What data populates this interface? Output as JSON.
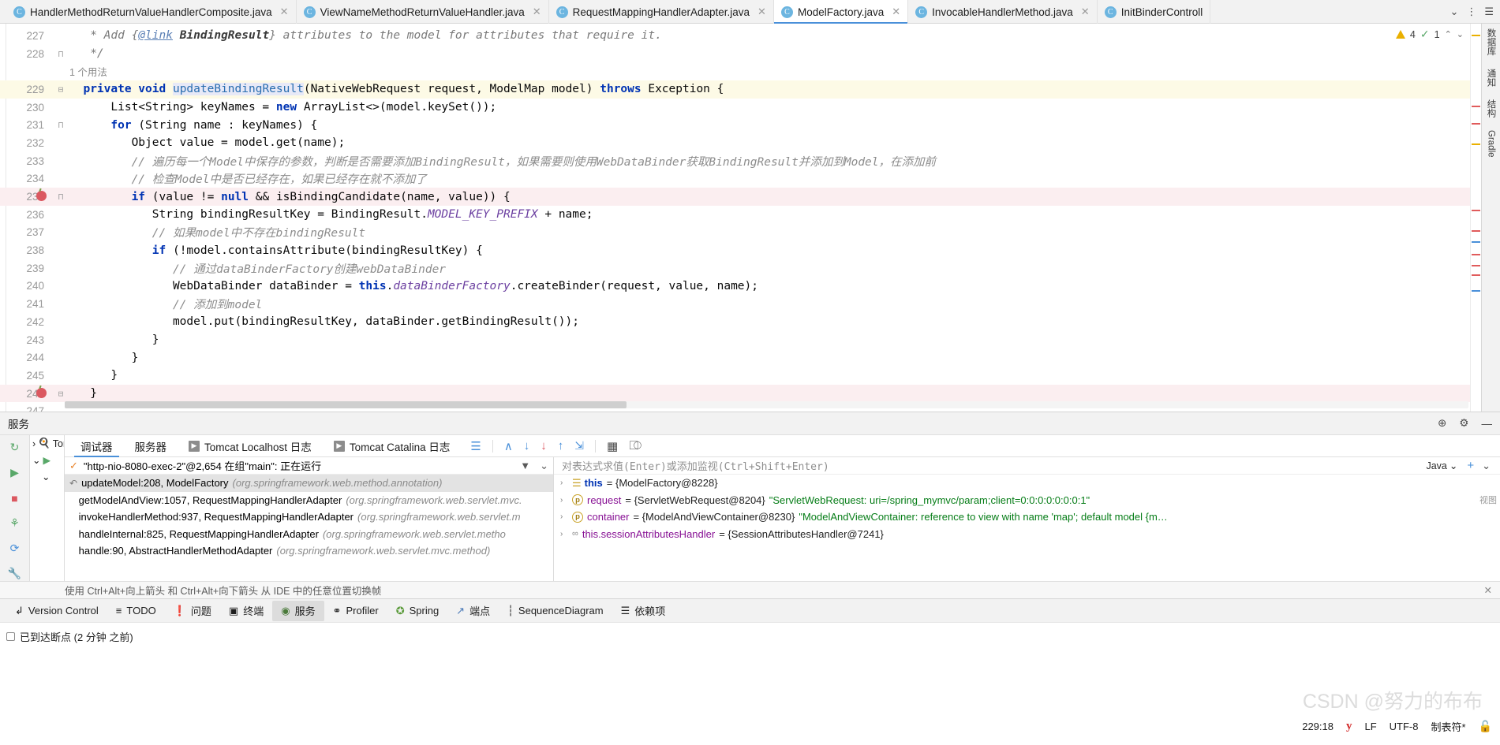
{
  "tabs": [
    {
      "label": "HandlerMethodReturnValueHandlerComposite.java",
      "icon": "java-class-icon",
      "active": false,
      "closable": true
    },
    {
      "label": "ViewNameMethodReturnValueHandler.java",
      "icon": "java-class-icon",
      "active": false,
      "closable": true
    },
    {
      "label": "RequestMappingHandlerAdapter.java",
      "icon": "java-class-icon",
      "active": false,
      "closable": true
    },
    {
      "label": "ModelFactory.java",
      "icon": "java-class-icon",
      "active": true,
      "closable": true
    },
    {
      "label": "InvocableHandlerMethod.java",
      "icon": "java-class-icon",
      "active": false,
      "closable": true
    },
    {
      "label": "InitBinderControll",
      "icon": "java-class-icon",
      "active": false,
      "closable": false
    }
  ],
  "tabbar": {
    "overflow_label": "⌄",
    "more_label": "⋮",
    "db_label": "☰"
  },
  "editor": {
    "inspection": {
      "warning_count": "4",
      "ok_count": "1",
      "chevron_up": "⌃",
      "chevron_down": "⌄"
    },
    "lines": [
      {
        "no": "227",
        "fold": "",
        "bp": false,
        "hl": "",
        "segs": [
          {
            "t": "   * Add {",
            "c": "cmtdoc"
          },
          {
            "t": "@link",
            "c": "lnk"
          },
          {
            "t": " ",
            "c": "cmtdoc"
          },
          {
            "t": "BindingResult",
            "c": "bold"
          },
          {
            "t": "} attributes to the model for attributes that require it.",
            "c": "cmtdoc"
          }
        ]
      },
      {
        "no": "228",
        "fold": "⊓",
        "bp": false,
        "hl": "",
        "segs": [
          {
            "t": "   */",
            "c": "cmtdoc"
          }
        ]
      },
      {
        "no": "",
        "fold": "",
        "bp": false,
        "hl": "",
        "usage": "1 个用法"
      },
      {
        "no": "229",
        "fold": "⊟",
        "bp": false,
        "hl": "hl2",
        "segs": [
          {
            "t": "  ",
            "c": "txt"
          },
          {
            "t": "private void ",
            "c": "kw"
          },
          {
            "t": "updateBindingResult",
            "c": "mthdecl"
          },
          {
            "t": "(NativeWebRequest request, ModelMap model) ",
            "c": "txt"
          },
          {
            "t": "throws ",
            "c": "kw"
          },
          {
            "t": "Exception {",
            "c": "txt"
          }
        ]
      },
      {
        "no": "230",
        "fold": "",
        "bp": false,
        "hl": "",
        "segs": [
          {
            "t": "      List<String> keyNames = ",
            "c": "txt"
          },
          {
            "t": "new ",
            "c": "kw"
          },
          {
            "t": "ArrayList<>(model.keySet());",
            "c": "txt"
          }
        ]
      },
      {
        "no": "231",
        "fold": "⊓",
        "bp": false,
        "hl": "",
        "segs": [
          {
            "t": "      ",
            "c": "txt"
          },
          {
            "t": "for ",
            "c": "kw"
          },
          {
            "t": "(String name : keyNames) {",
            "c": "txt"
          }
        ]
      },
      {
        "no": "232",
        "fold": "",
        "bp": false,
        "hl": "",
        "segs": [
          {
            "t": "         Object value = model.get(name);",
            "c": "txt"
          }
        ]
      },
      {
        "no": "233",
        "fold": "",
        "bp": false,
        "hl": "",
        "segs": [
          {
            "t": "         // 遍历每一个Model中保存的参数，判断是否需要添加BindingResult，如果需要则使用WebDataBinder获取BindingResult并添加到Model，在添加前",
            "c": "cmt"
          }
        ]
      },
      {
        "no": "234",
        "fold": "",
        "bp": false,
        "hl": "",
        "segs": [
          {
            "t": "         // 检查Model中是否已经存在，如果已经存在就不添加了",
            "c": "cmt"
          }
        ]
      },
      {
        "no": "235",
        "fold": "⊓",
        "bp": true,
        "hl": "hl",
        "segs": [
          {
            "t": "         ",
            "c": "txt"
          },
          {
            "t": "if ",
            "c": "kw"
          },
          {
            "t": "(value != ",
            "c": "txt"
          },
          {
            "t": "null ",
            "c": "kw"
          },
          {
            "t": "&& isBindingCandidate(name, value)) {",
            "c": "txt"
          }
        ]
      },
      {
        "no": "236",
        "fold": "",
        "bp": false,
        "hl": "",
        "segs": [
          {
            "t": "            String bindingResultKey = BindingResult.",
            "c": "txt"
          },
          {
            "t": "MODEL_KEY_PREFIX",
            "c": "cnst"
          },
          {
            "t": " + name;",
            "c": "txt"
          }
        ]
      },
      {
        "no": "237",
        "fold": "",
        "bp": false,
        "hl": "",
        "segs": [
          {
            "t": "            // 如果model中不存在bindingResult",
            "c": "cmt"
          }
        ]
      },
      {
        "no": "238",
        "fold": "",
        "bp": false,
        "hl": "",
        "segs": [
          {
            "t": "            ",
            "c": "txt"
          },
          {
            "t": "if ",
            "c": "kw"
          },
          {
            "t": "(!model.containsAttribute(bindingResultKey) {",
            "c": "txt"
          }
        ]
      },
      {
        "no": "239",
        "fold": "",
        "bp": false,
        "hl": "",
        "segs": [
          {
            "t": "               // 通过dataBinderFactory创建webDataBinder",
            "c": "cmt"
          }
        ]
      },
      {
        "no": "240",
        "fold": "",
        "bp": false,
        "hl": "",
        "segs": [
          {
            "t": "               WebDataBinder dataBinder = ",
            "c": "txt"
          },
          {
            "t": "this",
            "c": "kw"
          },
          {
            "t": ".",
            "c": "txt"
          },
          {
            "t": "dataBinderFactory",
            "c": "fld"
          },
          {
            "t": ".createBinder(request, value, name);",
            "c": "txt"
          }
        ]
      },
      {
        "no": "241",
        "fold": "",
        "bp": false,
        "hl": "",
        "segs": [
          {
            "t": "               // 添加到model",
            "c": "cmt"
          }
        ]
      },
      {
        "no": "242",
        "fold": "",
        "bp": false,
        "hl": "",
        "segs": [
          {
            "t": "               model.put(bindingResultKey, dataBinder.getBindingResult());",
            "c": "txt"
          }
        ]
      },
      {
        "no": "243",
        "fold": "",
        "bp": false,
        "hl": "",
        "segs": [
          {
            "t": "            }",
            "c": "txt"
          }
        ]
      },
      {
        "no": "244",
        "fold": "",
        "bp": false,
        "hl": "",
        "segs": [
          {
            "t": "         }",
            "c": "txt"
          }
        ]
      },
      {
        "no": "245",
        "fold": "",
        "bp": false,
        "hl": "",
        "segs": [
          {
            "t": "      }",
            "c": "txt"
          }
        ]
      },
      {
        "no": "246",
        "fold": "⊟",
        "bp": true,
        "hl": "hl",
        "segs": [
          {
            "t": "   }",
            "c": "txt"
          }
        ]
      },
      {
        "no": "247",
        "fold": "",
        "bp": false,
        "hl": "",
        "segs": [
          {
            "t": "",
            "c": "txt"
          }
        ]
      }
    ]
  },
  "rightbar": {
    "items": [
      "数据库",
      "通知",
      "结构",
      "Gradle"
    ]
  },
  "services": {
    "title": "服务",
    "header_tools": [
      "⊕",
      "⚙",
      "—"
    ],
    "tabs": [
      {
        "label": "调试器",
        "active": true,
        "icon": null
      },
      {
        "label": "服务器",
        "active": false,
        "icon": null
      },
      {
        "label": "Tomcat Localhost 日志",
        "active": false,
        "icon": "play-square-icon"
      },
      {
        "label": "Tomcat Catalina 日志",
        "active": false,
        "icon": "play-square-icon"
      }
    ],
    "toolbar_icons": [
      "layout-icon",
      "step-over-icon",
      "step-into-icon",
      "force-step-into-icon",
      "step-out-icon",
      "run-to-cursor-icon",
      "evaluate-icon",
      "mute-breakpoints-icon"
    ],
    "tree_rows": [
      "↻",
      "▶",
      "■",
      "⚓",
      "⟳",
      "🔧"
    ]
  },
  "debugger": {
    "thread": {
      "icon": "check-icon",
      "label": "\"http-nio-8080-exec-2\"@2,654 在组\"main\": 正在运行",
      "filter_icon": "filter-icon",
      "dropdown_icon": "⌄"
    },
    "frames": [
      {
        "method": "updateModel:208, ModelFactory",
        "pkg": "(org.springframework.web.method.annotation)",
        "selected": true,
        "icon": "return-arrow-icon"
      },
      {
        "method": "getModelAndView:1057, RequestMappingHandlerAdapter",
        "pkg": "(org.springframework.web.servlet.mvc.",
        "selected": false,
        "icon": null
      },
      {
        "method": "invokeHandlerMethod:937, RequestMappingHandlerAdapter",
        "pkg": "(org.springframework.web.servlet.m",
        "selected": false,
        "icon": null
      },
      {
        "method": "handleInternal:825, RequestMappingHandlerAdapter",
        "pkg": "(org.springframework.web.servlet.metho",
        "selected": false,
        "icon": null
      },
      {
        "method": "handle:90, AbstractHandlerMethodAdapter",
        "pkg": "(org.springframework.web.servlet.mvc.method)",
        "selected": false,
        "icon": null
      }
    ],
    "evaluate": {
      "placeholder": "对表达式求值(Enter)或添加监视(Ctrl+Shift+Enter)",
      "language": "Java",
      "language_caret": "⌄",
      "add_icon": "+",
      "settings_icon": "⌄"
    },
    "variables": [
      {
        "expand": "›",
        "badge": "this",
        "badge_type": "this",
        "name": "this",
        "name_style": "blue",
        "value": "= {ModelFactory@8228}",
        "string": ""
      },
      {
        "expand": "›",
        "badge": "p",
        "badge_type": "param",
        "name": "request",
        "name_style": "purple",
        "value": "= {ServletWebRequest@8204}",
        "string": "\"ServletWebRequest: uri=/spring_mymvc/param;client=0:0:0:0:0:0:0:1\""
      },
      {
        "expand": "›",
        "badge": "p",
        "badge_type": "param",
        "name": "container",
        "name_style": "purple",
        "value": "= {ModelAndViewContainer@8230}",
        "string": "\"ModelAndViewContainer: reference to view with name 'map'; default model {m…"
      },
      {
        "expand": "›",
        "badge": "oo",
        "badge_type": "field",
        "name": "this.sessionAttributesHandler",
        "name_style": "purple",
        "value": "= {SessionAttributesHandler@7241}",
        "string": ""
      }
    ],
    "view_hint": "视图"
  },
  "tip": {
    "text": "使用 Ctrl+Alt+向上箭头 和 Ctrl+Alt+向下箭头 从 IDE 中的任意位置切换帧",
    "close": "✕"
  },
  "bottombar": {
    "items": [
      {
        "label": "Version Control",
        "icon": "branch-icon",
        "active": false
      },
      {
        "label": "TODO",
        "icon": "list-icon",
        "active": false
      },
      {
        "label": "问题",
        "icon": "error-icon",
        "active": false
      },
      {
        "label": "终端",
        "icon": "terminal-icon",
        "active": false
      },
      {
        "label": "服务",
        "icon": "services-icon",
        "active": true
      },
      {
        "label": "Profiler",
        "icon": "profiler-icon",
        "active": false
      },
      {
        "label": "Spring",
        "icon": "spring-leaf-icon",
        "active": false
      },
      {
        "label": "端点",
        "icon": "endpoints-icon",
        "active": false
      },
      {
        "label": "SequenceDiagram",
        "icon": "sequence-icon",
        "active": false
      },
      {
        "label": "依赖项",
        "icon": "dependencies-icon",
        "active": false
      }
    ]
  },
  "statusbar": {
    "message": "已到达断点 (2 分钟 之前)",
    "message_icon": "breakpoint-icon",
    "caret": "229:18",
    "indexing_icon": "y",
    "line_sep": "LF",
    "encoding": "UTF-8",
    "indent": "制表符*",
    "lock_icon": "unlocked-icon",
    "watermark": "CSDN @努力的布布"
  }
}
